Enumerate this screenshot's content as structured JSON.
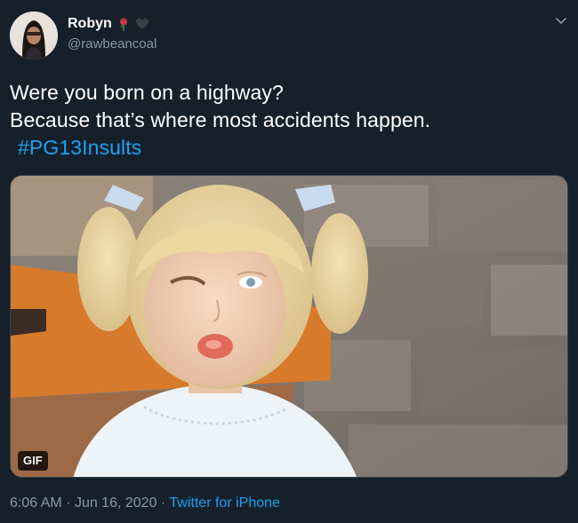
{
  "tweet": {
    "author": {
      "display_name": "Robyn",
      "handle": "@rawbeancoal",
      "emoji": [
        "rose-icon",
        "black-heart-icon"
      ]
    },
    "text_lines": [
      "Were you born on a highway?",
      "Because that’s where most accidents happen."
    ],
    "hashtag": "#PG13Insults",
    "media": {
      "type": "gif",
      "badge": "GIF"
    },
    "time": "6:06 AM",
    "date": "Jun 16, 2020",
    "source": "Twitter for iPhone",
    "separator": "·"
  },
  "colors": {
    "background": "#15202b",
    "text": "#ffffff",
    "secondary": "#8899a6",
    "link": "#1da1f2"
  }
}
